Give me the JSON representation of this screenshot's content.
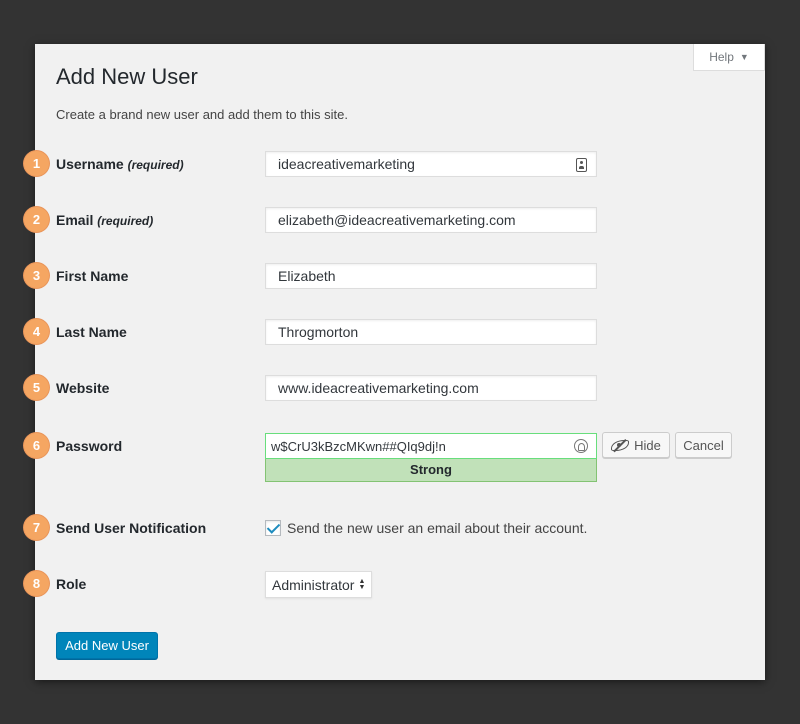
{
  "help_tab": {
    "label": "Help",
    "caret": "▼"
  },
  "header": {
    "title": "Add New User",
    "description": "Create a brand new user and add them to this site."
  },
  "fields": {
    "username": {
      "step": "1",
      "label": "Username",
      "required": "(required)",
      "value": "ideacreativemarketing"
    },
    "email": {
      "step": "2",
      "label": "Email",
      "required": "(required)",
      "value": "elizabeth@ideacreativemarketing.com"
    },
    "first_name": {
      "step": "3",
      "label": "First Name",
      "value": "Elizabeth"
    },
    "last_name": {
      "step": "4",
      "label": "Last Name",
      "value": "Throgmorton"
    },
    "website": {
      "step": "5",
      "label": "Website",
      "value": "www.ideacreativemarketing.com"
    },
    "password": {
      "step": "6",
      "label": "Password",
      "value": "w$CrU3kBzcMKwn##QIq9dj!n",
      "strength": "Strong",
      "hide_label": "Hide",
      "cancel_label": "Cancel"
    },
    "notification": {
      "step": "7",
      "label": "Send User Notification",
      "checked": true,
      "checkbox_label": "Send the new user an email about their account."
    },
    "role": {
      "step": "8",
      "label": "Role",
      "selected": "Administrator"
    }
  },
  "submit_label": "Add New User",
  "colors": {
    "background": "#333333",
    "panel": "#f1f1f1",
    "step_badge": "#f5a662",
    "primary_button": "#0085ba",
    "strength_strong": "#c1e1b9"
  }
}
